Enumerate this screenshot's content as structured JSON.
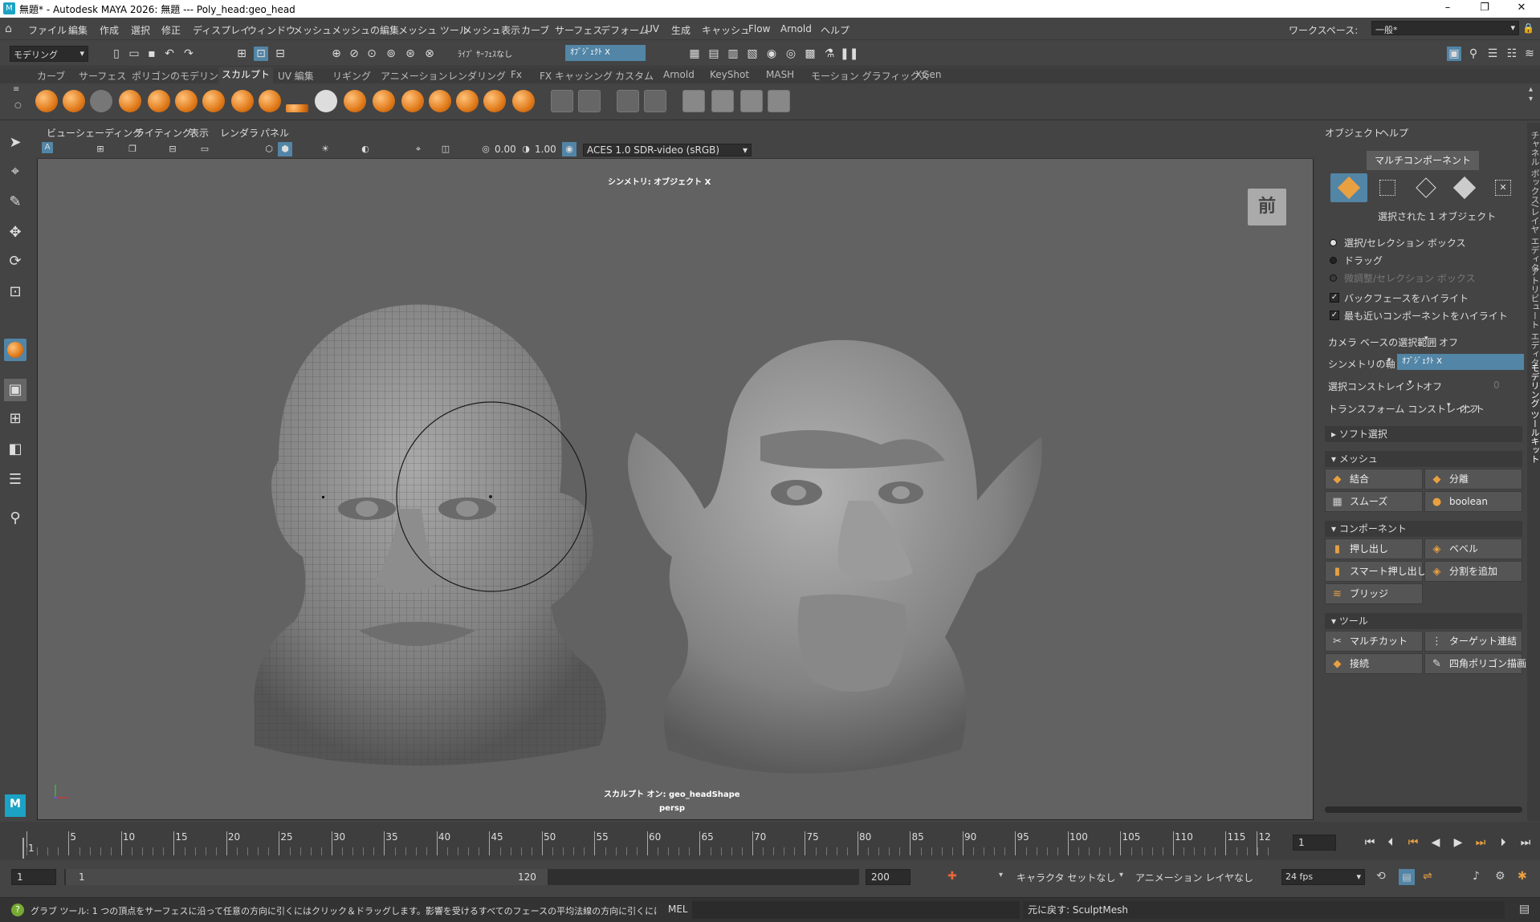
{
  "window": {
    "title": "無題* - Autodesk MAYA 2026: 無題   ---   Poly_head:geo_head",
    "minimize": "–",
    "maximize": "❐",
    "close": "✕"
  },
  "menu": {
    "items": [
      "ファイル",
      "編集",
      "作成",
      "選択",
      "修正",
      "ディスプレイ",
      "ウィンドウ",
      "メッシュ",
      "メッシュの編集",
      "メッシュ ツール",
      "メッシュ表示",
      "カーブ",
      "サーフェス",
      "デフォーム",
      "UV",
      "生成",
      "キャッシュ",
      "Flow",
      "Arnold",
      "ヘルプ"
    ],
    "workspace_label": "ワークスペース:",
    "workspace_value": "一般*"
  },
  "status": {
    "mode": "モデリング",
    "live_surface": "ﾗｲﾌﾞ ｻｰﾌｪｽなし",
    "symmetry": "ｵﾌﾞｼﾞｪｸﾄ X"
  },
  "shelf": {
    "tabs": [
      "カーブ",
      "サーフェス",
      "ポリゴンのモデリング",
      "スカルプト",
      "UV 編集",
      "リギング",
      "アニメーション",
      "レンダリング",
      "Fx",
      "FX キャッシング",
      "カスタム",
      "Arnold",
      "KeyShot",
      "MASH",
      "モーション グラフィックス",
      "XGen"
    ],
    "active_tab": "スカルプト"
  },
  "viewport": {
    "menu": [
      "ビュー",
      "シェーディング",
      "ライティング",
      "表示",
      "レンダラ",
      "パネル"
    ],
    "value1": "0.00",
    "value2": "1.00",
    "color_mgmt": "ACES 1.0 SDR-video (sRGB)",
    "symmetry_label": "シンメトリ: オブジェクト X",
    "sculpt_label": "スカルプト オン: geo_headShape",
    "camera": "persp",
    "view_cube": "前"
  },
  "panel": {
    "menu": [
      "オブジェクト",
      "ヘルプ"
    ],
    "multicomponent": "マルチコンポーネント",
    "selected_count": "選択された 1 オブジェクト",
    "options": [
      {
        "label": "選択/セレクション ボックス",
        "on": true
      },
      {
        "label": "ドラッグ",
        "on": false
      },
      {
        "label": "微調整/セレクション ボックス",
        "on": false
      }
    ],
    "checks": [
      {
        "label": "バックフェースをハイライト",
        "checked": true
      },
      {
        "label": "最も近いコンポーネントをハイライト",
        "checked": true
      }
    ],
    "camera_based": "カメラ ベースの選択範囲",
    "camera_based_value": "オフ",
    "sym_axis": "シンメトリの軸",
    "sym_axis_value": "ｵﾌﾞｼﾞｪｸﾄ X",
    "sel_constraint": "選択コンストレイント",
    "sel_constraint_value": "オフ",
    "sel_constraint_num": "0",
    "xform_constraint": "トランスフォーム コンストレイント",
    "xform_constraint_value": "オフ",
    "soft_select": "ソフト選択",
    "mesh": {
      "title": "メッシュ",
      "buttons": [
        "結合",
        "分離",
        "スムーズ",
        "boolean"
      ]
    },
    "component": {
      "title": "コンポーネント",
      "buttons": [
        "押し出し",
        "ベベル",
        "スマート押し出し",
        "分割を追加",
        "ブリッジ"
      ]
    },
    "tools": {
      "title": "ツール",
      "buttons": [
        "マルチカット",
        "ターゲット連結",
        "接続",
        "四角ポリゴン描画"
      ]
    }
  },
  "side_tabs": [
    "チャネル ボックス/レイヤ エディタ",
    "アトリビュート エディタ",
    "モデリング ツールキット"
  ],
  "timeline": {
    "ticks": [
      "1",
      "5",
      "10",
      "15",
      "20",
      "25",
      "30",
      "35",
      "40",
      "45",
      "50",
      "55",
      "60",
      "65",
      "70",
      "75",
      "80",
      "85",
      "90",
      "95",
      "100",
      "105",
      "110",
      "115",
      "12"
    ],
    "current": "1"
  },
  "range": {
    "start": "1",
    "inner_start": "1",
    "inner_end": "120",
    "end": "200",
    "char_set": "キャラクタ セットなし",
    "anim_layer": "アニメーション レイヤなし",
    "fps": "24 fps"
  },
  "help": {
    "text": "グラブ ツール: 1 つの頂点をサーフェスに沿って任意の方向に引くにはクリック＆ドラッグします。影響を受けるすべてのフェースの平均法線の方向に引くには[Ctrl]キーを押しながらドラッグし",
    "mel": "MEL",
    "result": "元に戻す: SculptMesh"
  }
}
